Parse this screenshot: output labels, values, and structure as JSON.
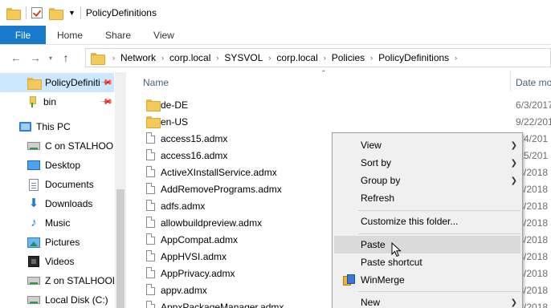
{
  "window": {
    "title": "PolicyDefinitions"
  },
  "ribbon": {
    "tabs": [
      {
        "label": "File"
      },
      {
        "label": "Home"
      },
      {
        "label": "Share"
      },
      {
        "label": "View"
      }
    ]
  },
  "address": {
    "crumbs": [
      "Network",
      "corp.local",
      "SYSVOL",
      "corp.local",
      "Policies",
      "PolicyDefinitions"
    ]
  },
  "sidebar": {
    "items": [
      {
        "label": "PolicyDefiniti",
        "icon": "folder-icon",
        "pinned": true,
        "selected": true
      },
      {
        "label": "bin",
        "icon": "folder-pin-icon",
        "pinned": true
      },
      {
        "label": "This PC",
        "icon": "this-pc-icon"
      },
      {
        "label": "C on STALHOOD",
        "icon": "network-drive-icon"
      },
      {
        "label": "Desktop",
        "icon": "desktop-icon"
      },
      {
        "label": "Documents",
        "icon": "documents-icon"
      },
      {
        "label": "Downloads",
        "icon": "downloads-icon"
      },
      {
        "label": "Music",
        "icon": "music-icon"
      },
      {
        "label": "Pictures",
        "icon": "pictures-icon"
      },
      {
        "label": "Videos",
        "icon": "videos-icon"
      },
      {
        "label": "Z on STALHOOD",
        "icon": "network-drive-icon"
      },
      {
        "label": "Local Disk (C:)",
        "icon": "local-disk-icon"
      }
    ]
  },
  "filelist": {
    "headers": {
      "name": "Name",
      "date": "Date mo"
    },
    "rows": [
      {
        "name": "de-DE",
        "type": "folder",
        "date": "6/3/2017"
      },
      {
        "name": "en-US",
        "type": "folder",
        "date": "9/22/201"
      },
      {
        "name": "access15.admx",
        "type": "file",
        "date": "/24/201"
      },
      {
        "name": "access16.admx",
        "type": "file",
        "date": "/25/201"
      },
      {
        "name": "ActiveXInstallService.admx",
        "type": "file",
        "date": "/3/2018"
      },
      {
        "name": "AddRemovePrograms.admx",
        "type": "file",
        "date": "/3/2018"
      },
      {
        "name": "adfs.admx",
        "type": "file",
        "date": "/3/2018"
      },
      {
        "name": "allowbuildpreview.admx",
        "type": "file",
        "date": "/3/2018"
      },
      {
        "name": "AppCompat.admx",
        "type": "file",
        "date": "/3/2018"
      },
      {
        "name": "AppHVSI.admx",
        "type": "file",
        "date": "/3/2018"
      },
      {
        "name": "AppPrivacy.admx",
        "type": "file",
        "date": "/3/2018"
      },
      {
        "name": "appv.admx",
        "type": "file",
        "date": "/3/2018"
      },
      {
        "name": "AppxPackageManager.admx",
        "type": "file",
        "date": "/3/2018"
      }
    ]
  },
  "context_menu": {
    "items": [
      {
        "label": "View",
        "submenu": true
      },
      {
        "label": "Sort by",
        "submenu": true
      },
      {
        "label": "Group by",
        "submenu": true
      },
      {
        "label": "Refresh"
      },
      {
        "label": "Customize this folder..."
      },
      {
        "label": "Paste",
        "hover": true
      },
      {
        "label": "Paste shortcut"
      },
      {
        "label": "WinMerge",
        "icon": "winmerge-icon"
      },
      {
        "label": "New",
        "submenu": true
      }
    ]
  }
}
